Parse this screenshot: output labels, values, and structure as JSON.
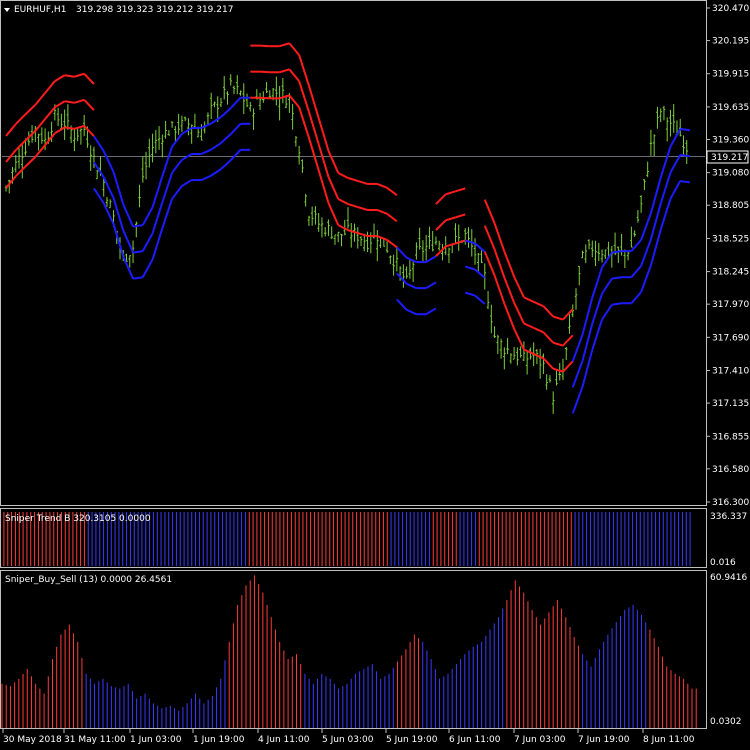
{
  "chart_data": [
    {
      "type": "line",
      "panel": "price",
      "title": "EURHUF,H1",
      "quote": "319.298 319.323 319.212 319.217",
      "current_price": "319.217",
      "y_ticks": [
        "320.470",
        "320.195",
        "319.915",
        "319.635",
        "319.360",
        "319.080",
        "318.805",
        "318.525",
        "318.245",
        "317.970",
        "317.690",
        "317.410",
        "317.135",
        "316.855",
        "316.580",
        "316.300"
      ],
      "ylim": [
        316.3,
        320.47
      ],
      "colors": {
        "candles": "#7ecf3a",
        "bull_band": "#1c1cff",
        "bear_band": "#ff1c1c",
        "marker": "#ffffff",
        "grid_current": "#a9b0ba"
      },
      "series": [
        {
          "name": "Close",
          "values": [
            318.95,
            319.15,
            319.3,
            319.45,
            319.35,
            319.55,
            319.5,
            319.4,
            319.45,
            319.2,
            319.0,
            318.7,
            318.35,
            318.45,
            319.05,
            319.3,
            319.4,
            319.45,
            319.48,
            319.5,
            319.4,
            319.6,
            319.7,
            319.8,
            319.75,
            319.6,
            319.7,
            319.78,
            319.75,
            319.7,
            319.3,
            318.75,
            318.65,
            318.6,
            318.55,
            318.58,
            318.55,
            318.5,
            318.55,
            318.45,
            318.3,
            318.15,
            318.4,
            318.45,
            318.5,
            318.48,
            318.5,
            318.55,
            318.4,
            318.2,
            317.7,
            317.6,
            317.55,
            317.5,
            317.55,
            317.45,
            317.2,
            317.4,
            317.9,
            318.35,
            318.45,
            318.42,
            318.4,
            318.4,
            318.45,
            318.8,
            319.3,
            319.6,
            319.5,
            319.4,
            319.25
          ]
        }
      ]
    },
    {
      "type": "bar",
      "panel": "trend",
      "title": "Sniper Trend B 320.3105 0.0000",
      "y_ticks": [
        "336.337",
        "0.016"
      ],
      "ylim": [
        0,
        336.337
      ],
      "colors": {
        "up": "#3a3aff",
        "down": "#ff3a3a"
      },
      "segments": [
        {
          "color": "red",
          "bars": 22
        },
        {
          "color": "blue",
          "bars": 42
        },
        {
          "color": "red",
          "bars": 37
        },
        {
          "color": "blue",
          "bars": 11
        },
        {
          "color": "red",
          "bars": 7
        },
        {
          "color": "blue",
          "bars": 5
        },
        {
          "color": "red",
          "bars": 25
        },
        {
          "color": "blue",
          "bars": 31
        }
      ]
    },
    {
      "type": "bar",
      "panel": "buysell",
      "title": "Sniper_Buy_Sell (13) 0.0000 26.4561",
      "y_ticks": [
        "60.9416",
        "0.0302"
      ],
      "ylim": [
        0,
        60.9416
      ],
      "colors": {
        "up": "#3a3aff",
        "down": "#ff3a3a"
      },
      "values": [
        18,
        17,
        20,
        24,
        18,
        14,
        28,
        38,
        42,
        35,
        22,
        18,
        20,
        17,
        16,
        18,
        12,
        14,
        10,
        8,
        9,
        7,
        10,
        14,
        10,
        13,
        20,
        35,
        50,
        58,
        62,
        55,
        45,
        35,
        28,
        30,
        22,
        18,
        22,
        20,
        16,
        18,
        22,
        24,
        26,
        20,
        22,
        27,
        32,
        38,
        35,
        28,
        20,
        22,
        26,
        30,
        33,
        35,
        40,
        45,
        52,
        60,
        55,
        48,
        42,
        47,
        52,
        45,
        37,
        30,
        25,
        32,
        38,
        43,
        48,
        50,
        46,
        40,
        33,
        25,
        22,
        20,
        16
      ],
      "value_colors": [
        "r",
        "r",
        "r",
        "r",
        "r",
        "r",
        "r",
        "r",
        "r",
        "r",
        "b",
        "b",
        "b",
        "b",
        "b",
        "b",
        "b",
        "b",
        "b",
        "b",
        "b",
        "b",
        "b",
        "b",
        "b",
        "b",
        "b",
        "r",
        "r",
        "r",
        "r",
        "r",
        "r",
        "r",
        "r",
        "r",
        "b",
        "b",
        "b",
        "b",
        "b",
        "b",
        "b",
        "b",
        "b",
        "b",
        "b",
        "r",
        "r",
        "r",
        "b",
        "b",
        "b",
        "b",
        "b",
        "b",
        "b",
        "b",
        "b",
        "b",
        "r",
        "r",
        "r",
        "r",
        "r",
        "r",
        "r",
        "r",
        "r",
        "b",
        "b",
        "b",
        "b",
        "b",
        "b",
        "b",
        "b",
        "r",
        "r",
        "r",
        "r",
        "r",
        "r"
      ],
      "x_ticks": [
        "30 May 2018",
        "31 May 11:00",
        "1 Jun 03:00",
        "1 Jun 19:00",
        "4 Jun 11:00",
        "5 Jun 03:00",
        "5 Jun 19:00",
        "6 Jun 11:00",
        "7 Jun 03:00",
        "7 Jun 19:00",
        "8 Jun 11:00"
      ]
    }
  ]
}
